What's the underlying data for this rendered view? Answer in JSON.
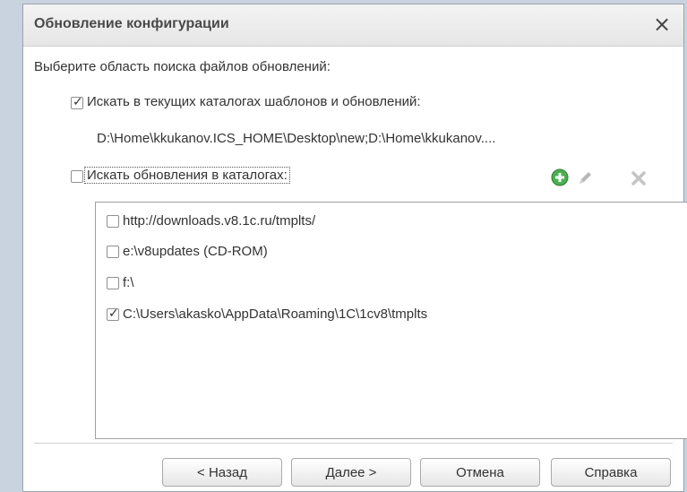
{
  "dialog": {
    "title": "Обновление конфигурации",
    "close_icon": "×",
    "prompt": "Выберите область поиска файлов обновлений:",
    "option_current": {
      "checked": true,
      "label": "Искать в текущих каталогах шаблонов и обновлений:",
      "path": "D:\\Home\\kkukanov.ICS_HOME\\Desktop\\new;D:\\Home\\kkukanov...."
    },
    "option_dirs": {
      "checked": false,
      "label": "Искать обновления в каталогах:"
    },
    "toolbar": {
      "add_icon": "add-icon",
      "edit_icon": "pencil-icon",
      "delete_icon": "delete-icon"
    },
    "directories": [
      {
        "checked": false,
        "path": "http://downloads.v8.1c.ru/tmplts/"
      },
      {
        "checked": false,
        "path": "e:\\v8updates (CD-ROM)"
      },
      {
        "checked": false,
        "path": "f:\\"
      },
      {
        "checked": true,
        "path": "C:\\Users\\akasko\\AppData\\Roaming\\1C\\1cv8\\tmplts"
      }
    ],
    "buttons": {
      "back": "< Назад",
      "next": "Далее >",
      "cancel": "Отмена",
      "help": "Справка"
    }
  }
}
